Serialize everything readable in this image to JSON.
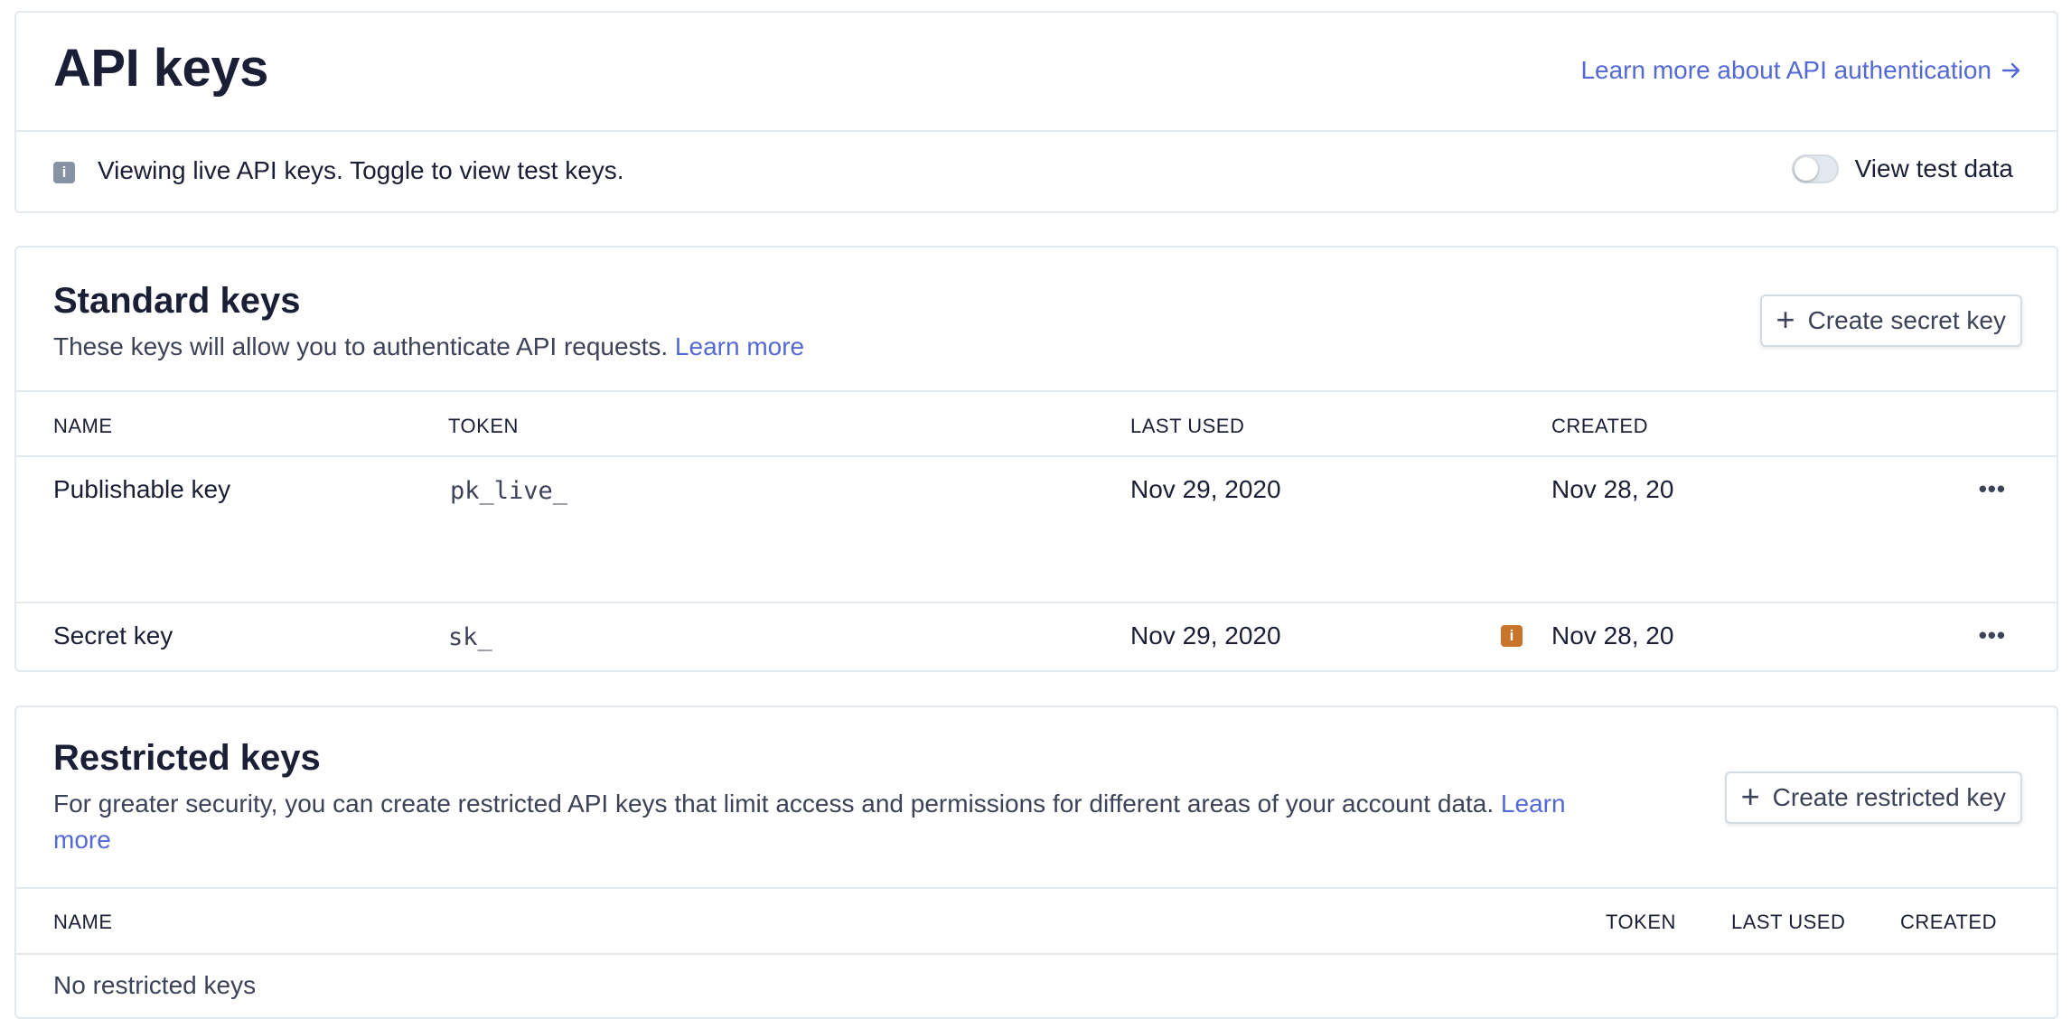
{
  "header": {
    "title": "API keys",
    "learn_link": "Learn more about API authentication",
    "learn_link_icon": "arrow-right-icon",
    "info_icon": "info-icon",
    "info_text": "Viewing live API keys. Toggle to view test keys.",
    "toggle_label": "View test data",
    "toggle_on": false
  },
  "standard": {
    "title": "Standard keys",
    "description": "These keys will allow you to authenticate API requests.",
    "learn_more": "Learn more",
    "create_button": "Create secret key",
    "columns": {
      "name": "NAME",
      "token": "TOKEN",
      "last_used": "LAST USED",
      "created": "CREATED"
    },
    "rows": [
      {
        "name": "Publishable key",
        "token": "pk_live_",
        "last_used": "Nov 29, 2020",
        "created": "Nov 28, 20",
        "menu": "•••"
      },
      {
        "name": "Secret key",
        "token": "sk_",
        "last_used": "Nov 29, 2020",
        "created": "Nov 28, 20",
        "menu": "•••",
        "warning_icon": "info-icon"
      }
    ]
  },
  "restricted": {
    "title": "Restricted keys",
    "description": "For greater security, you can create restricted API keys that limit access and permissions for different areas of your account data.",
    "learn_more_1": "Learn",
    "learn_more_2": "more",
    "create_button": "Create restricted key",
    "columns": {
      "name": "NAME",
      "token": "TOKEN",
      "last_used": "LAST USED",
      "created": "CREATED"
    },
    "empty_text": "No restricted keys"
  },
  "colors": {
    "link": "#5469d4",
    "text": "#1a1f36",
    "border": "#e3e8ee",
    "warning": "#c9742c",
    "info": "#8792a2"
  }
}
